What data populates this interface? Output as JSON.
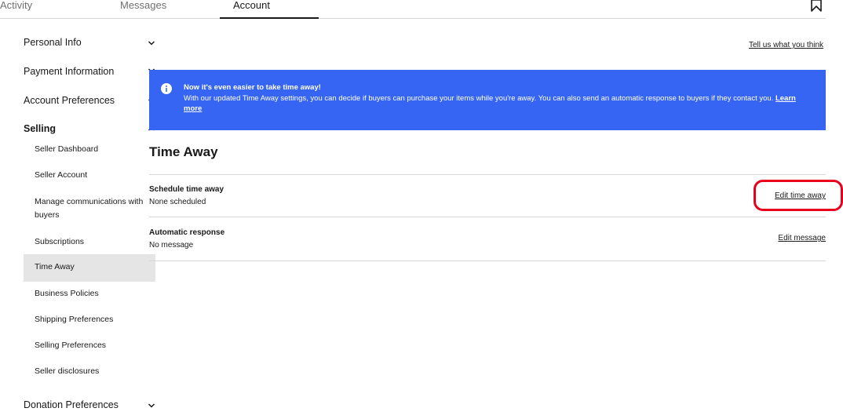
{
  "top_tabs": {
    "activity": "Activity",
    "messages": "Messages",
    "account": "Account"
  },
  "sidebar": {
    "groups": {
      "personal_info": "Personal Info",
      "payment_information": "Payment Information",
      "account_preferences": "Account Preferences",
      "selling": "Selling",
      "donation_preferences": "Donation Preferences"
    },
    "selling_items": [
      "Seller Dashboard",
      "Seller Account",
      "Manage communications with buyers",
      "Subscriptions",
      "Time Away",
      "Business Policies",
      "Shipping Preferences",
      "Selling Preferences",
      "Seller disclosures"
    ],
    "active_item": "Time Away"
  },
  "feedback_link": "Tell us what you think",
  "banner": {
    "title": "Now it's even easier to take time away!",
    "body": "With our updated Time Away settings, you can decide if buyers can purchase your items while you're away. You can also send an automatic response to buyers if they contact you.",
    "link": "Learn more",
    "color": "#3665f3"
  },
  "main": {
    "title": "Time Away",
    "rows": [
      {
        "label": "Schedule time away",
        "value": "None scheduled",
        "action": "Edit time away"
      },
      {
        "label": "Automatic response",
        "value": "No message",
        "action": "Edit message"
      }
    ]
  },
  "icons": {
    "bookmark": "bookmark-icon",
    "info": "info-icon",
    "chevron_down": "chevron-down-icon",
    "chevron_up": "chevron-up-icon"
  },
  "colors": {
    "highlight": "#e8001c",
    "active_bg": "#e5e5e5"
  }
}
